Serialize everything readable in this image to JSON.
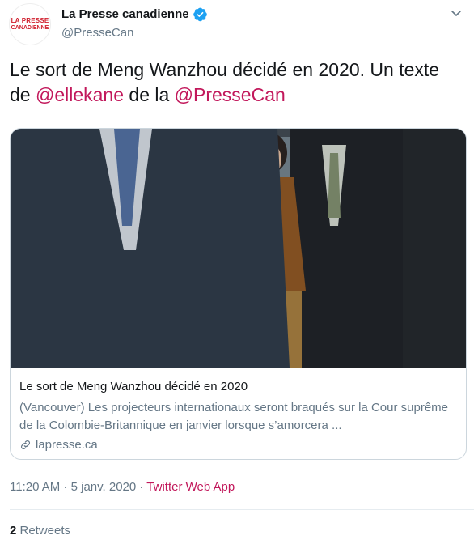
{
  "author": {
    "avatar_line1": "LA PRESSE",
    "avatar_line2": "CANADIENNE",
    "name": "La Presse canadienne",
    "handle": "@PresseCan"
  },
  "tweet": {
    "text_part1": "Le sort de Meng Wanzhou décidé en 2020. Un texte de ",
    "mention1": "@ellekane",
    "text_part2": " de la ",
    "mention2": "@PresseCan"
  },
  "card": {
    "title": "Le sort de Meng Wanzhou décidé en 2020",
    "description": "(Vancouver) Les projecteurs internationaux seront braqués sur la Cour suprême de la Colombie-Britannique en janvier lorsque s’amorcera ...",
    "domain": "lapresse.ca"
  },
  "meta": {
    "time": "11:20 AM",
    "sep1": " · ",
    "date": "5 janv. 2020",
    "sep2": " · ",
    "source": "Twitter Web App"
  },
  "stats": {
    "retweet_count": "2",
    "retweet_label": " Retweets"
  },
  "colors": {
    "mention": "#c2185b",
    "verified": "#1da1f2",
    "brand_red": "#d0202e"
  },
  "icons": [
    "verified-badge-icon",
    "chevron-down-icon",
    "link-icon"
  ]
}
